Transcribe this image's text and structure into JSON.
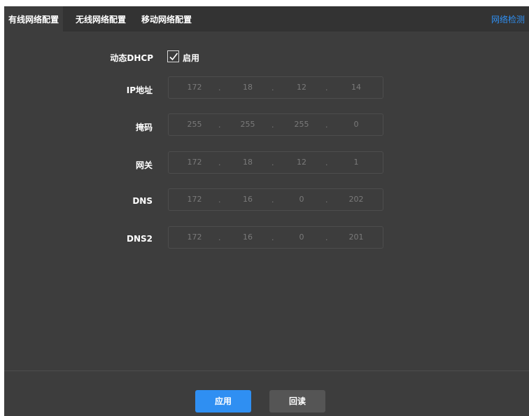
{
  "tabs": [
    {
      "label": "有线网络配置",
      "active": true
    },
    {
      "label": "无线网络配置",
      "active": false
    },
    {
      "label": "移动网络配置",
      "active": false
    }
  ],
  "net_check_label": "网络检测",
  "dhcp": {
    "label": "动态DHCP",
    "checkbox_label": "启用",
    "checked": true
  },
  "fields": [
    {
      "label": "IP地址",
      "octets": [
        "172",
        "18",
        "12",
        "14"
      ]
    },
    {
      "label": "掩码",
      "octets": [
        "255",
        "255",
        "255",
        "0"
      ]
    },
    {
      "label": "网关",
      "octets": [
        "172",
        "18",
        "12",
        "1"
      ]
    },
    {
      "label": "DNS",
      "octets": [
        "172",
        "16",
        "0",
        "202"
      ]
    },
    {
      "label": "DNS2",
      "octets": [
        "172",
        "16",
        "0",
        "201"
      ]
    }
  ],
  "separator": ".",
  "buttons": {
    "apply": "应用",
    "read_back": "回读"
  },
  "colors": {
    "accent": "#2f8ff2",
    "panel": "#3d3d3d",
    "tabbar": "#333333"
  },
  "icons": {
    "checkbox": "check-icon"
  }
}
